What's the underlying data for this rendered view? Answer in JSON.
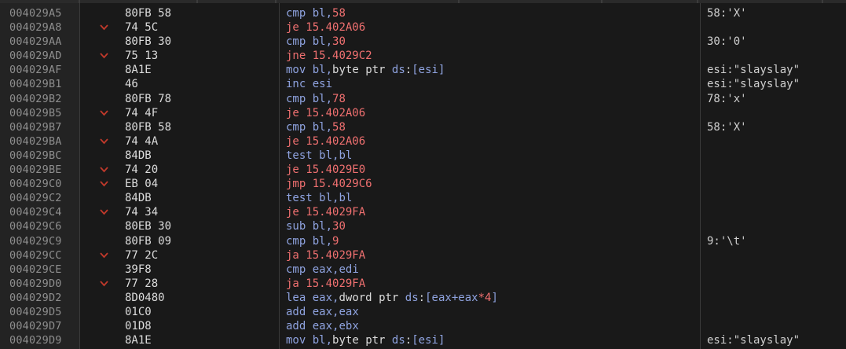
{
  "rows": [
    {
      "addr": "004029A5",
      "bytes": "80FB 58",
      "jump": false,
      "mnemonic": "cmp",
      "operands": "bl,58",
      "kind": "normal",
      "comment": "58:'X'"
    },
    {
      "addr": "004029A8",
      "bytes": "74 5C",
      "jump": true,
      "mnemonic": "je",
      "operands": "15.402A06",
      "kind": "jump",
      "comment": ""
    },
    {
      "addr": "004029AA",
      "bytes": "80FB 30",
      "jump": false,
      "mnemonic": "cmp",
      "operands": "bl,30",
      "kind": "normal",
      "comment": "30:'0'"
    },
    {
      "addr": "004029AD",
      "bytes": "75 13",
      "jump": true,
      "mnemonic": "jne",
      "operands": "15.4029C2",
      "kind": "jump",
      "comment": ""
    },
    {
      "addr": "004029AF",
      "bytes": "8A1E",
      "jump": false,
      "mnemonic": "mov",
      "operands": "bl,byte ptr ds:[esi]",
      "kind": "mem",
      "comment": "esi:\"slayslay\""
    },
    {
      "addr": "004029B1",
      "bytes": "46",
      "jump": false,
      "mnemonic": "inc",
      "operands": "esi",
      "kind": "normal",
      "comment": "esi:\"slayslay\""
    },
    {
      "addr": "004029B2",
      "bytes": "80FB 78",
      "jump": false,
      "mnemonic": "cmp",
      "operands": "bl,78",
      "kind": "normal",
      "comment": "78:'x'"
    },
    {
      "addr": "004029B5",
      "bytes": "74 4F",
      "jump": true,
      "mnemonic": "je",
      "operands": "15.402A06",
      "kind": "jump",
      "comment": ""
    },
    {
      "addr": "004029B7",
      "bytes": "80FB 58",
      "jump": false,
      "mnemonic": "cmp",
      "operands": "bl,58",
      "kind": "normal",
      "comment": "58:'X'"
    },
    {
      "addr": "004029BA",
      "bytes": "74 4A",
      "jump": true,
      "mnemonic": "je",
      "operands": "15.402A06",
      "kind": "jump",
      "comment": ""
    },
    {
      "addr": "004029BC",
      "bytes": "84DB",
      "jump": false,
      "mnemonic": "test",
      "operands": "bl,bl",
      "kind": "normal",
      "comment": ""
    },
    {
      "addr": "004029BE",
      "bytes": "74 20",
      "jump": true,
      "mnemonic": "je",
      "operands": "15.4029E0",
      "kind": "jump",
      "comment": ""
    },
    {
      "addr": "004029C0",
      "bytes": "EB 04",
      "jump": true,
      "mnemonic": "jmp",
      "operands": "15.4029C6",
      "kind": "jump",
      "comment": ""
    },
    {
      "addr": "004029C2",
      "bytes": "84DB",
      "jump": false,
      "mnemonic": "test",
      "operands": "bl,bl",
      "kind": "normal",
      "comment": ""
    },
    {
      "addr": "004029C4",
      "bytes": "74 34",
      "jump": true,
      "mnemonic": "je",
      "operands": "15.4029FA",
      "kind": "jump",
      "comment": ""
    },
    {
      "addr": "004029C6",
      "bytes": "80EB 30",
      "jump": false,
      "mnemonic": "sub",
      "operands": "bl,30",
      "kind": "normal",
      "comment": ""
    },
    {
      "addr": "004029C9",
      "bytes": "80FB 09",
      "jump": false,
      "mnemonic": "cmp",
      "operands": "bl,9",
      "kind": "normal",
      "comment": "9:'\\t'"
    },
    {
      "addr": "004029CC",
      "bytes": "77 2C",
      "jump": true,
      "mnemonic": "ja",
      "operands": "15.4029FA",
      "kind": "jump",
      "comment": ""
    },
    {
      "addr": "004029CE",
      "bytes": "39F8",
      "jump": false,
      "mnemonic": "cmp",
      "operands": "eax,edi",
      "kind": "normal",
      "comment": ""
    },
    {
      "addr": "004029D0",
      "bytes": "77 28",
      "jump": true,
      "mnemonic": "ja",
      "operands": "15.4029FA",
      "kind": "jump",
      "comment": ""
    },
    {
      "addr": "004029D2",
      "bytes": "8D0480",
      "jump": false,
      "mnemonic": "lea",
      "operands": "eax,dword ptr ds:[eax+eax*4]",
      "kind": "lea",
      "comment": ""
    },
    {
      "addr": "004029D5",
      "bytes": "01C0",
      "jump": false,
      "mnemonic": "add",
      "operands": "eax,eax",
      "kind": "normal",
      "comment": ""
    },
    {
      "addr": "004029D7",
      "bytes": "01D8",
      "jump": false,
      "mnemonic": "add",
      "operands": "eax,ebx",
      "kind": "normal",
      "comment": ""
    },
    {
      "addr": "004029D9",
      "bytes": "8A1E",
      "jump": false,
      "mnemonic": "mov",
      "operands": "bl,byte ptr ds:[esi]",
      "kind": "mem",
      "comment": "esi:\"slayslay\""
    }
  ],
  "jump_arrow_icon": "chevron-down-icon",
  "colors": {
    "background": "#191919",
    "gutter": "#232323",
    "address": "#8e8e8e",
    "bytes": "#dcdcdc",
    "mnemonic": "#8fa3e0",
    "jump": "#f07070",
    "arrow": "#c0392b",
    "comment": "#cfcfcf"
  }
}
